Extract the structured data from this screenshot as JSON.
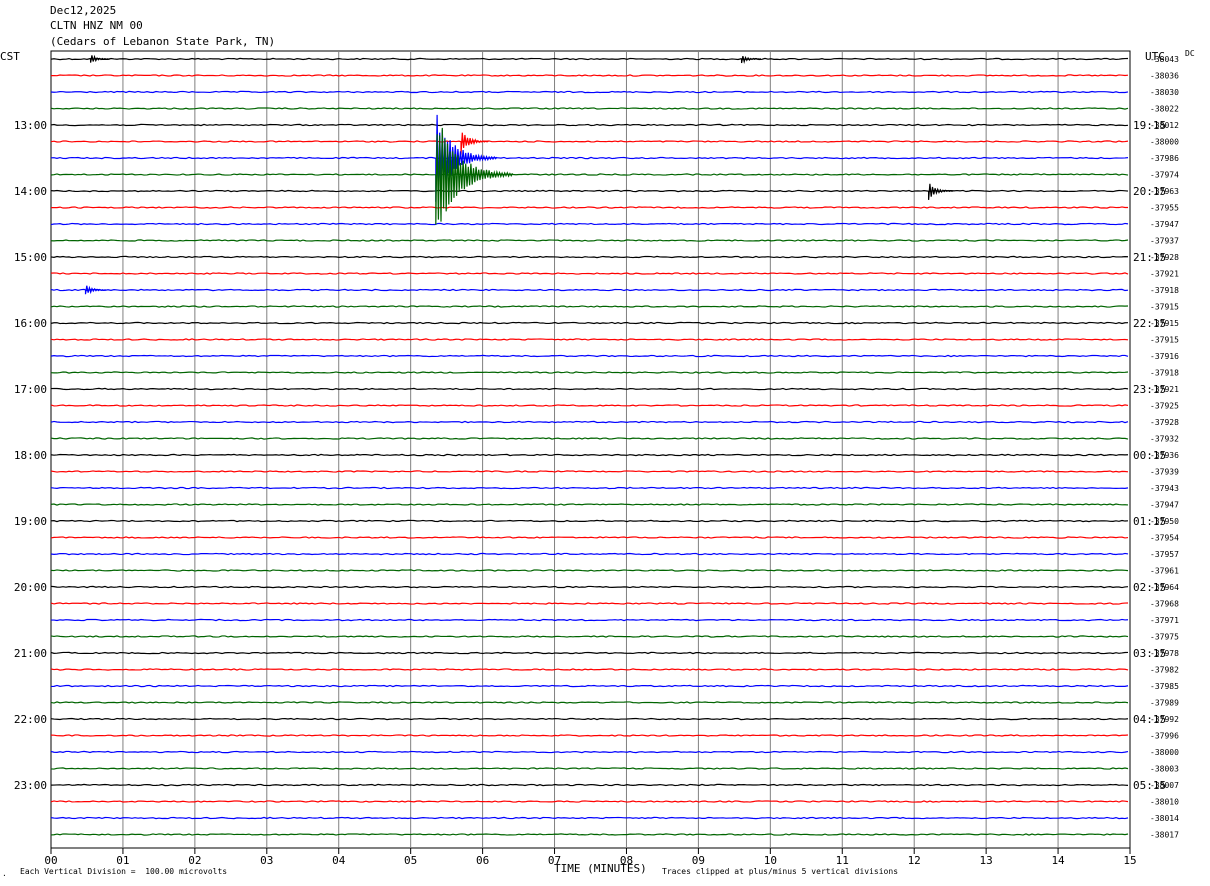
{
  "header": {
    "date": "Dec12,2025",
    "station": "CLTN HNZ NM 00",
    "location": "(Cedars of Lebanon State Park, TN)"
  },
  "left_tz": "CST",
  "right_tz": "UTC",
  "dc_label": "DC",
  "footer": {
    "vertical_division": "Each Vertical Division =  100.00 microvolts",
    "xlabel": "TIME (MINUTES)",
    "clip_note": "Traces clipped at plus/minus 5 vertical divisions"
  },
  "colors": {
    "trace_cycle": [
      "#000000",
      "#ff0000",
      "#0000ff",
      "#006400"
    ],
    "grid": "#808080"
  },
  "chart_data": {
    "type": "line",
    "title": "CLTN HNZ NM 00",
    "xlabel": "TIME (MINUTES)",
    "x_range": [
      0,
      15
    ],
    "x_ticks": [
      "00",
      "01",
      "02",
      "03",
      "04",
      "05",
      "06",
      "07",
      "08",
      "09",
      "10",
      "11",
      "12",
      "13",
      "14",
      "15"
    ],
    "left_hour_labels": [
      "13:00",
      "14:00",
      "15:00",
      "16:00",
      "17:00",
      "18:00",
      "19:00",
      "20:00",
      "21:00",
      "22:00",
      "23:00"
    ],
    "right_hour_labels": [
      "19:15",
      "20:15",
      "21:15",
      "22:15",
      "23:15",
      "00:15",
      "01:15",
      "02:15",
      "03:15",
      "04:15",
      "05:15"
    ],
    "dc_offsets": [
      "-38043",
      "-38036",
      "-38030",
      "-38022",
      "-38012",
      "-38000",
      "-37986",
      "-37974",
      "-37963",
      "-37955",
      "-37947",
      "-37937",
      "-37928",
      "-37921",
      "-37918",
      "-37915",
      "-37915",
      "-37915",
      "-37916",
      "-37918",
      "-37921",
      "-37925",
      "-37928",
      "-37932",
      "-37936",
      "-37939",
      "-37943",
      "-37947",
      "-37950",
      "-37954",
      "-37957",
      "-37961",
      "-37964",
      "-37968",
      "-37971",
      "-37975",
      "-37978",
      "-37982",
      "-37985",
      "-37989",
      "-37992",
      "-37996",
      "-38000",
      "-38003",
      "-38007",
      "-38010",
      "-38014",
      "-38017"
    ],
    "events": [
      {
        "trace": 0,
        "minute": 0.55,
        "amplitude": 0.3
      },
      {
        "trace": 0,
        "minute": 9.6,
        "amplitude": 0.3
      },
      {
        "trace": 5,
        "minute": 5.7,
        "amplitude": 0.8
      },
      {
        "trace": 6,
        "minute": 5.35,
        "amplitude": 3
      },
      {
        "trace": 7,
        "minute": 5.35,
        "amplitude": 4
      },
      {
        "trace": 8,
        "minute": 12.2,
        "amplitude": 0.6
      },
      {
        "trace": 14,
        "minute": 0.48,
        "amplitude": 0.4
      }
    ]
  }
}
